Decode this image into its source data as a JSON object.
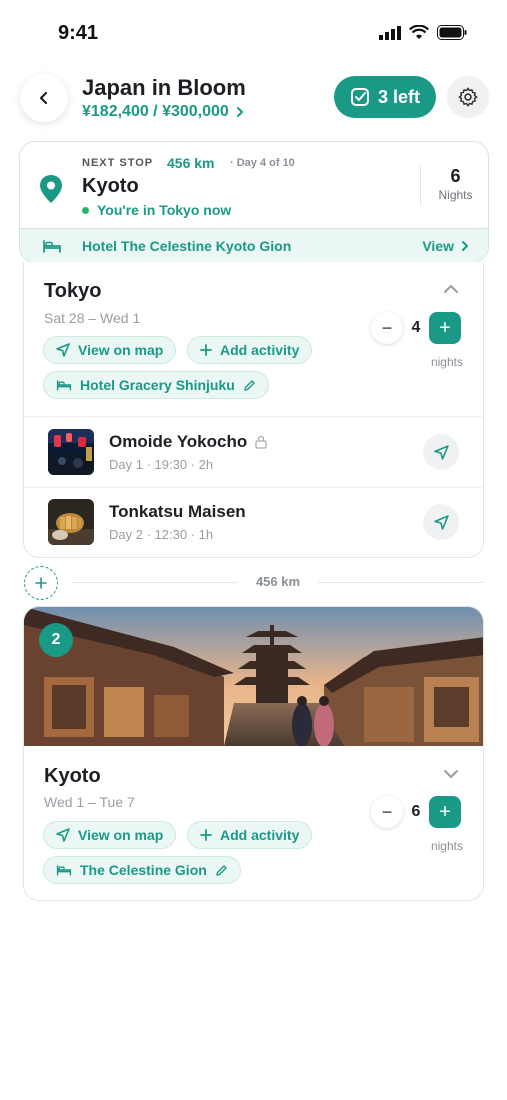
{
  "status": {
    "time": "9:41"
  },
  "header": {
    "title": "Japan in Bloom",
    "budget": "¥182,400 / ¥300,000",
    "tasks_label": "3 left"
  },
  "next_stop": {
    "label": "NEXT STOP",
    "distance": "456 km",
    "day": "· Day 4 of 10",
    "city": "Kyoto",
    "status": "You're in Tokyo now",
    "nights_value": "6",
    "nights_label": "Nights",
    "hotel": "Hotel The Celestine Kyoto Gion",
    "view_label": "View"
  },
  "tokyo": {
    "name": "Tokyo",
    "dates": "Sat 28 – Wed 1",
    "nights": "4",
    "nights_label": "nights",
    "view_map": "View on map",
    "add_activity": "Add activity",
    "hotel": "Hotel Gracery Shinjuku",
    "activities": [
      {
        "title": "Omoide Yokocho",
        "meta": "Day 1 · 19:30 · 2h"
      },
      {
        "title": "Tonkatsu Maisen",
        "meta": "Day 2 · 12:30 · 1h"
      }
    ]
  },
  "connector": {
    "distance": "456 km"
  },
  "kyoto": {
    "badge": "2",
    "name": "Kyoto",
    "dates": "Wed 1 – Tue 7",
    "nights": "6",
    "nights_label": "nights",
    "view_map": "View on map",
    "add_activity": "Add activity",
    "hotel": "The Celestine Gion"
  },
  "colors": {
    "accent": "#1a9a86",
    "accent_bg": "#eaf7f4",
    "live_dot": "#27b36a"
  }
}
